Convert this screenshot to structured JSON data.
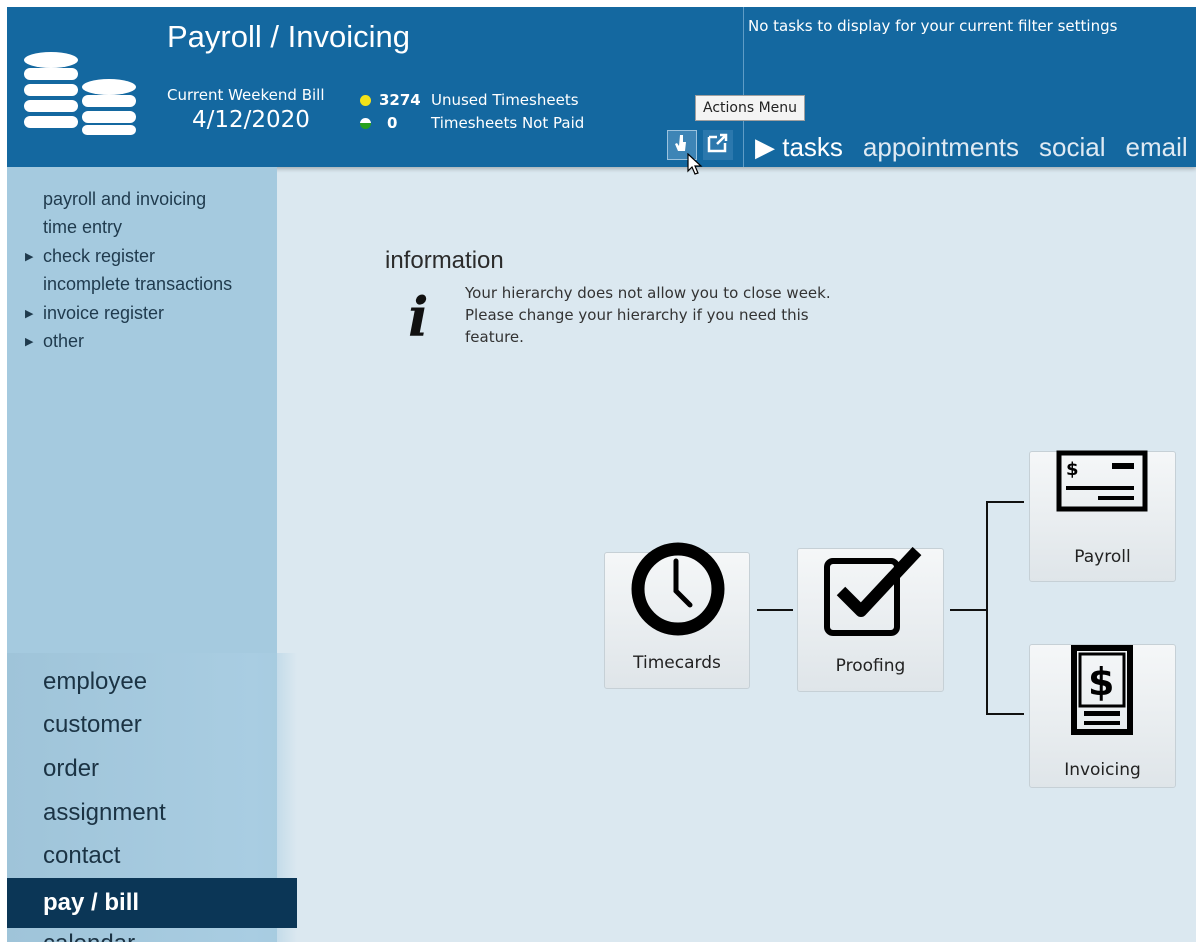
{
  "header": {
    "title": "Payroll / Invoicing",
    "bill_label": "Current Weekend Bill",
    "bill_date": "4/12/2020",
    "stats": [
      {
        "count": "3274",
        "label": "Unused Timesheets",
        "color": "#f3e219"
      },
      {
        "count": "0",
        "label": "Timesheets Not Paid",
        "color": "#27a01e"
      }
    ],
    "no_tasks": "No tasks to display for your current filter settings",
    "tooltip": "Actions Menu",
    "nav_tabs": [
      "▶ tasks",
      "appointments",
      "social",
      "email"
    ]
  },
  "sidebar": {
    "menu": [
      {
        "label": "payroll and invoicing",
        "arrow": ""
      },
      {
        "label": "time entry",
        "arrow": ""
      },
      {
        "label": "check register",
        "arrow": "▶"
      },
      {
        "label": "incomplete transactions",
        "arrow": ""
      },
      {
        "label": "invoice register",
        "arrow": "▶"
      },
      {
        "label": "other",
        "arrow": "▶"
      }
    ],
    "entities": [
      "employee",
      "customer",
      "order",
      "assignment",
      "contact",
      "pay / bill",
      "calendar"
    ]
  },
  "info": {
    "title": "information",
    "text": "Your hierarchy does not allow you to close week. Please change your hierarchy if you need this feature."
  },
  "workflow": {
    "timecards": "Timecards",
    "proofing": "Proofing",
    "payroll": "Payroll",
    "invoicing": "Invoicing"
  },
  "colors": {
    "header_bg": "#1468a0",
    "sidebar_bg": "#a5cadf",
    "active_item_bg": "#0b3656",
    "content_bg": "#dbe8f0"
  }
}
